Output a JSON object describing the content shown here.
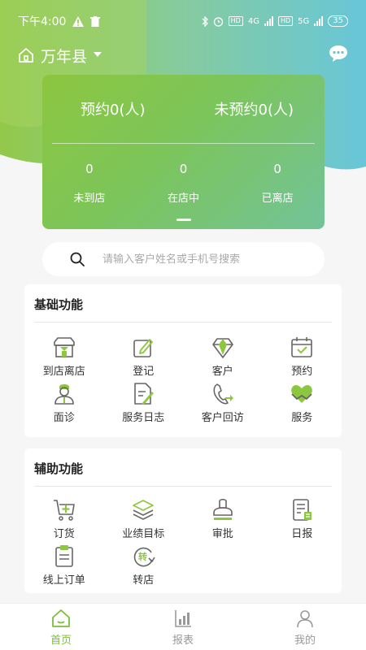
{
  "status_bar": {
    "time": "下午4:00",
    "hd1": "HD",
    "net1": "4G",
    "hd2": "HD",
    "net2": "5G",
    "battery": "35"
  },
  "header": {
    "location": "万年县"
  },
  "summary": {
    "reserved": "预约0(人)",
    "not_reserved": "未预约0(人)",
    "stats": [
      {
        "value": "0",
        "label": "未到店"
      },
      {
        "value": "0",
        "label": "在店中"
      },
      {
        "value": "0",
        "label": "已离店"
      }
    ]
  },
  "search": {
    "placeholder": "请输入客户姓名或手机号搜索"
  },
  "basic": {
    "title": "基础功能",
    "items": [
      {
        "label": "到店离店",
        "icon": "store-icon"
      },
      {
        "label": "登记",
        "icon": "register-icon"
      },
      {
        "label": "客户",
        "icon": "diamond-icon"
      },
      {
        "label": "预约",
        "icon": "calendar-icon"
      },
      {
        "label": "面诊",
        "icon": "doctor-icon"
      },
      {
        "label": "服务日志",
        "icon": "document-pen-icon"
      },
      {
        "label": "客户回访",
        "icon": "phone-callback-icon"
      },
      {
        "label": "服务",
        "icon": "heart-hands-icon"
      }
    ]
  },
  "assist": {
    "title": "辅助功能",
    "items": [
      {
        "label": "订货",
        "icon": "cart-icon"
      },
      {
        "label": "业绩目标",
        "icon": "layers-icon"
      },
      {
        "label": "审批",
        "icon": "stamp-icon"
      },
      {
        "label": "日报",
        "icon": "report-icon"
      },
      {
        "label": "线上订单",
        "icon": "clipboard-icon"
      },
      {
        "label": "转店",
        "icon": "transfer-icon"
      }
    ]
  },
  "tabs": {
    "home": "首页",
    "report": "报表",
    "mine": "我的"
  },
  "colors": {
    "accent": "#8dc63f",
    "icon_gray": "#666666"
  }
}
